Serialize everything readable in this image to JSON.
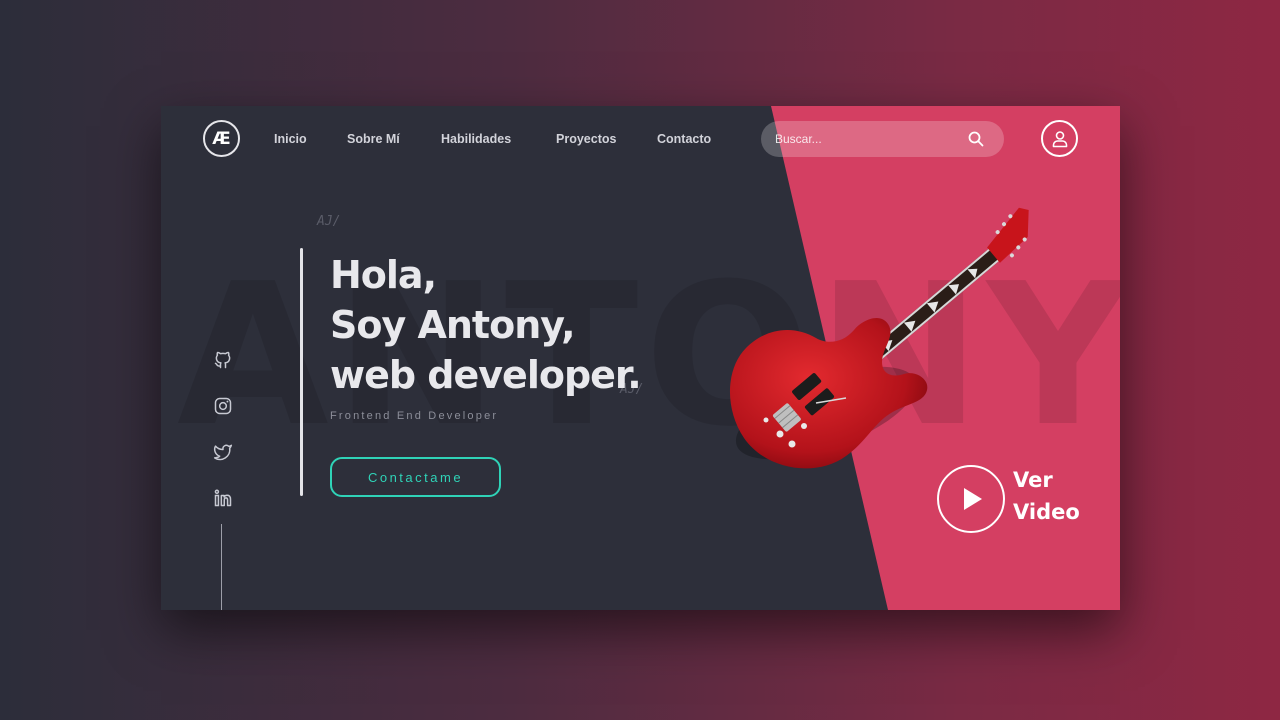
{
  "logo": {
    "text": "Æ"
  },
  "nav": {
    "items": [
      "Inicio",
      "Sobre Mí",
      "Habilidades",
      "Proyectos",
      "Contacto"
    ]
  },
  "search": {
    "placeholder": "Buscar...",
    "icon": "search-icon"
  },
  "user": {
    "icon": "user-icon"
  },
  "socials": [
    "github-icon",
    "instagram-icon",
    "twitter-icon",
    "linkedin-icon"
  ],
  "watermark": "ANTONY",
  "decorations": [
    "AJ/",
    "AJ/"
  ],
  "hero": {
    "line1": "Hola,",
    "line2": "Soy Antony,",
    "line3": "web developer.",
    "subtitle": "Frontend End Developer",
    "cta_label": "Contactame"
  },
  "video": {
    "line1": "Ver",
    "line2": "Video"
  },
  "colors": {
    "background": "#2d2f3a",
    "accent_pink": "#d43f62",
    "cta_teal": "#2fd3b7",
    "guitar_red": "#c8141b"
  }
}
